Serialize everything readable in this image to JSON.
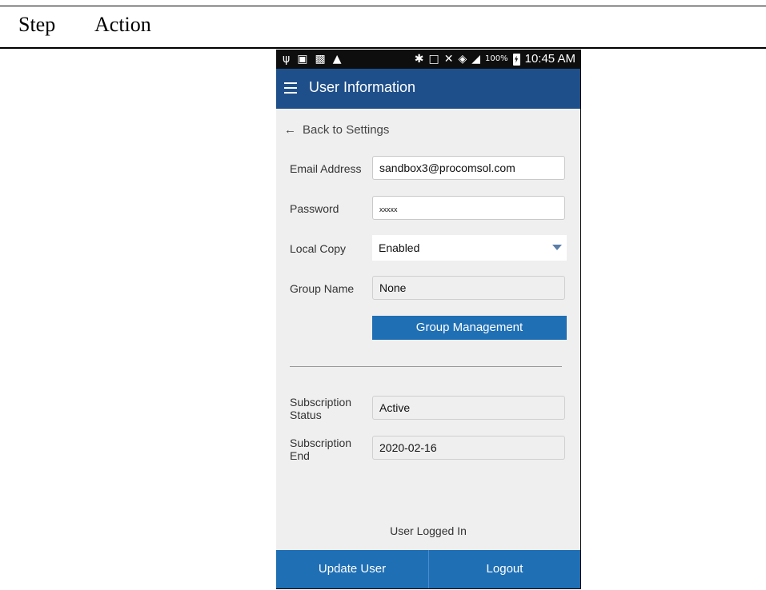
{
  "document": {
    "header_step": "Step",
    "header_action": "Action"
  },
  "statusbar": {
    "icons": [
      "usb-icon",
      "image-icon",
      "sim-icon",
      "warning-icon",
      "bluetooth-icon",
      "nfc-icon",
      "mute-icon",
      "wifi-icon",
      "signal-icon",
      "battery-icon"
    ],
    "battery_text": "100%",
    "time": "10:45 AM"
  },
  "appbar": {
    "title": "User Information",
    "color": "#1f4f8a"
  },
  "back": {
    "label": "Back to Settings"
  },
  "form": {
    "email_label": "Email Address",
    "email_value": "sandbox3@procomsol.com",
    "password_label": "Password",
    "password_value": "xxxxx",
    "local_copy_label": "Local Copy",
    "local_copy_value": "Enabled",
    "group_name_label": "Group Name",
    "group_name_value": "None",
    "group_button": "Group Management",
    "sub_status_label_1": "Subscription",
    "sub_status_label_2": "Status",
    "sub_status_value": "Active",
    "sub_end_label_1": "Subscription",
    "sub_end_label_2": "End",
    "sub_end_value": "2020-02-16"
  },
  "footer": {
    "status": "User Logged In",
    "update_button": "Update User",
    "logout_button": "Logout",
    "button_color": "#1f6fb5"
  }
}
